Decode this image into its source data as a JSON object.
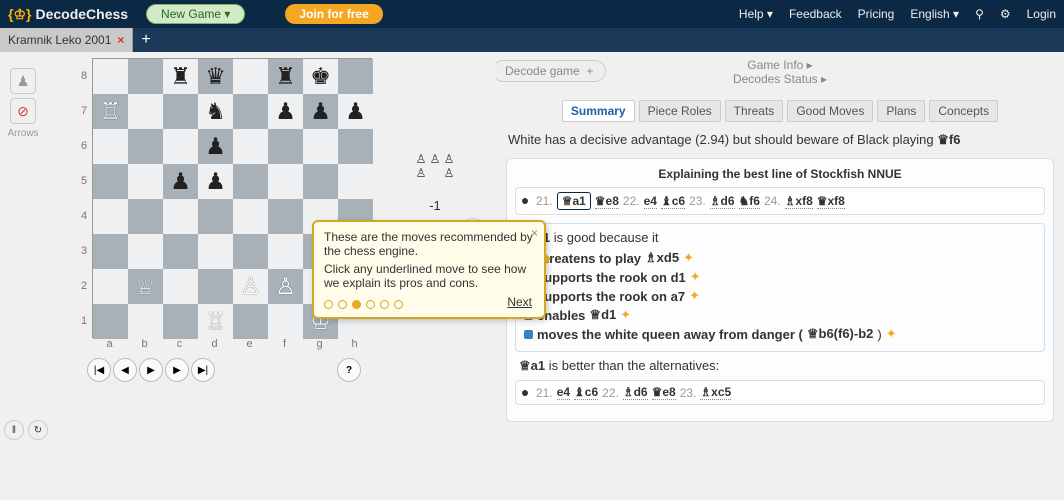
{
  "header": {
    "brand": "DecodeChess",
    "new_game": "New Game  ▾",
    "join": "Join for free",
    "menu": {
      "help": "Help ▾",
      "feedback": "Feedback",
      "pricing": "Pricing",
      "language": "English ▾",
      "login": "Login"
    }
  },
  "game_tab": {
    "title": "Kramnik Leko 2001"
  },
  "side_labels": {
    "arrows": "Arrows"
  },
  "board": {
    "ranks": [
      "8",
      "7",
      "6",
      "5",
      "4",
      "3",
      "2",
      "1"
    ],
    "files": [
      "a",
      "b",
      "c",
      "d",
      "e",
      "f",
      "g",
      "h"
    ],
    "pieces": {
      "a8": "",
      "b8": "",
      "c8": "♜",
      "d8": "♛",
      "e8": "",
      "f8": "♜",
      "g8": "♚",
      "h8": "",
      "a7": "♖",
      "b7": "",
      "c7": "",
      "d7": "♞",
      "e7": "",
      "f7": "♟",
      "g7": "♟",
      "h7": "♟",
      "a6": "",
      "b6": "",
      "c6": "",
      "d6": "♟",
      "e6": "",
      "f6": "",
      "g6": "",
      "h6": "",
      "a5": "",
      "b5": "",
      "c5": "♟",
      "d5": "♟",
      "e5": "",
      "f5": "",
      "g5": "",
      "h5": "",
      "a4": "",
      "b4": "",
      "c4": "",
      "d4": "",
      "e4": "",
      "f4": "",
      "g4": "",
      "h4": "",
      "a3": "",
      "b3": "",
      "c3": "",
      "d3": "",
      "e3": "",
      "f3": "",
      "g3": "",
      "h3": "",
      "a2": "",
      "b2": "♕",
      "c2": "",
      "d2": "",
      "e2": "♙",
      "f2": "♙",
      "g2": "",
      "h2": "",
      "a1": "",
      "b1": "",
      "c1": "",
      "d1": "♖",
      "e1": "",
      "f1": "",
      "g1": "♔",
      "h1": ""
    }
  },
  "preview": {
    "eval": "-1"
  },
  "right": {
    "game_info": "Game Info ▸",
    "decodes_status": "Decodes Status ▸",
    "decode_btn": "Decode game",
    "tabs": [
      "Summary",
      "Piece Roles",
      "Threats",
      "Good Moves",
      "Plans",
      "Concepts"
    ],
    "active_tab": "Summary",
    "advantage_pre": "White has a decisive advantage (2.94) but should beware of Black playing ",
    "advantage_move": "♛f6",
    "explain_title": "Explaining the best line of Stockfish NNUE",
    "best_line": [
      {
        "num": "21.",
        "piece": "♕",
        "sq": "a1",
        "boxed": true
      },
      {
        "piece": "♛",
        "sq": "e8"
      },
      {
        "num": "22.",
        "piece": "",
        "sq": "e4"
      },
      {
        "piece": "♝",
        "sq": "c6"
      },
      {
        "num": "23.",
        "piece": "♗",
        "sq": "d6"
      },
      {
        "piece": "♞",
        "sq": "f6"
      },
      {
        "num": "24.",
        "piece": "♗",
        "sq": "xf8"
      },
      {
        "piece": "♛",
        "sq": "xf8"
      }
    ],
    "good_move": "♕a1",
    "good_suffix": "  is good because it",
    "reasons": [
      {
        "pre": "threatens to play ",
        "mv": "♗xd5",
        "star": true
      },
      {
        "pre": "supports the rook on d1",
        "mv": "",
        "star": true
      },
      {
        "pre": "supports the rook on a7",
        "mv": "",
        "star": true
      },
      {
        "pre": "enables ",
        "mv": "♕d1",
        "star": true
      },
      {
        "pre": "moves the white queen away from danger (",
        "mv": "♕b6(f6)-b2",
        "post": ")",
        "star": true
      }
    ],
    "better_pre": "♕a1",
    "better_suffix": "  is better than the alternatives:",
    "alt_line": [
      {
        "num": "21.",
        "piece": "",
        "sq": "e4"
      },
      {
        "piece": "♝",
        "sq": "c6"
      },
      {
        "num": "22.",
        "piece": "♗",
        "sq": "d6"
      },
      {
        "piece": "♛",
        "sq": "e8"
      },
      {
        "num": "23.",
        "piece": "♗",
        "sq": "xc5"
      }
    ]
  },
  "tooltip": {
    "line1": "These are the moves recommended by the chess engine.",
    "line2": "Click any underlined move to see how we explain its pros and cons.",
    "next": "Next"
  }
}
